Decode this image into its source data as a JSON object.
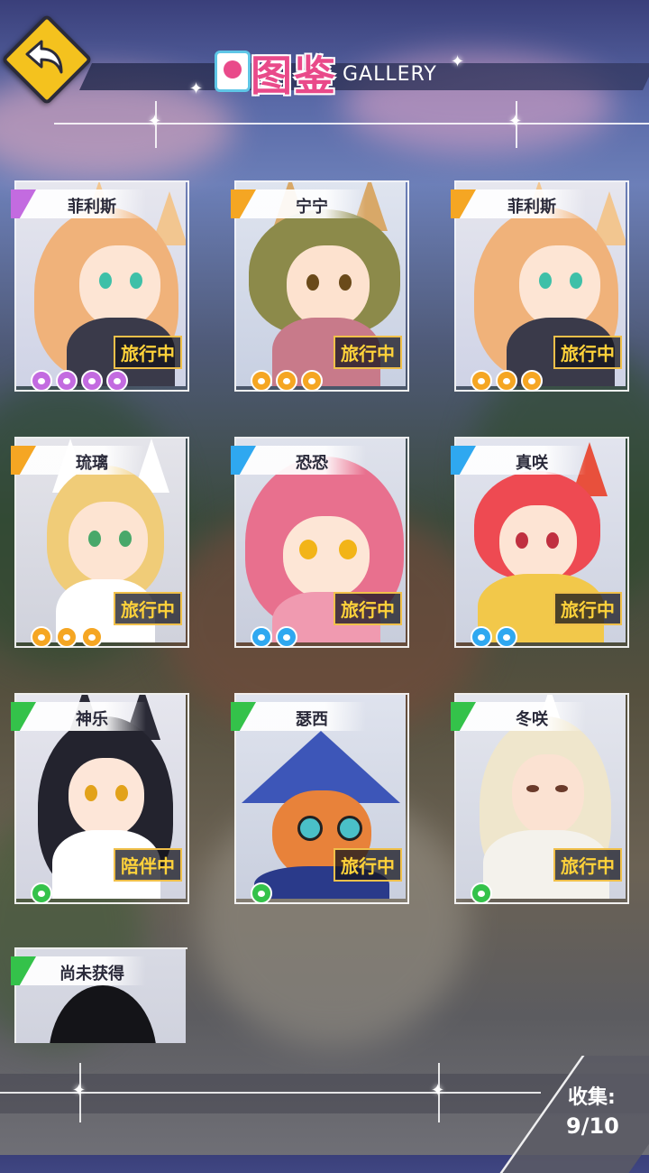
{
  "header": {
    "title_zh": "图鉴",
    "title_en": "GALLERY"
  },
  "colors": {
    "accent_yellow": "#f4c21e",
    "status_text": "#ffd23a",
    "rarity_purple": "#c36be0",
    "rarity_orange": "#f5a623",
    "rarity_blue": "#2fa8f0",
    "rarity_green": "#34c24a"
  },
  "cards": [
    {
      "name": "菲利斯",
      "status": "旅行中",
      "paws": 4,
      "rarity_color": "#c36be0"
    },
    {
      "name": "宁宁",
      "status": "旅行中",
      "paws": 3,
      "rarity_color": "#f5a623"
    },
    {
      "name": "菲利斯",
      "status": "旅行中",
      "paws": 3,
      "rarity_color": "#f5a623"
    },
    {
      "name": "琉璃",
      "status": "旅行中",
      "paws": 3,
      "rarity_color": "#f5a623"
    },
    {
      "name": "恐恐",
      "status": "旅行中",
      "paws": 2,
      "rarity_color": "#2fa8f0"
    },
    {
      "name": "真咲",
      "status": "旅行中",
      "paws": 2,
      "rarity_color": "#2fa8f0"
    },
    {
      "name": "神乐",
      "status": "陪伴中",
      "paws": 1,
      "rarity_color": "#34c24a"
    },
    {
      "name": "瑟西",
      "status": "旅行中",
      "paws": 1,
      "rarity_color": "#34c24a"
    },
    {
      "name": "冬咲",
      "status": "旅行中",
      "paws": 1,
      "rarity_color": "#34c24a"
    },
    {
      "name": "尚未获得",
      "status": "",
      "paws": 0,
      "rarity_color": "#34c24a"
    }
  ],
  "collection": {
    "label": "收集:",
    "value": "9/10"
  }
}
